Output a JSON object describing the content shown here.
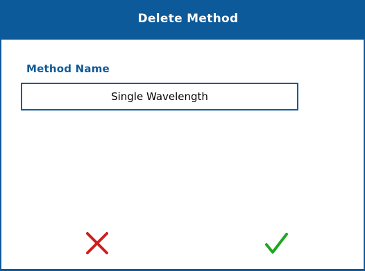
{
  "dialog": {
    "title": "Delete Method",
    "field_label": "Method Name",
    "method_name": "Single Wavelength"
  },
  "actions": {
    "cancel_icon": "red-x-icon",
    "confirm_icon": "green-checkmark-icon"
  },
  "colors": {
    "accent": "#0d5a9a",
    "cancel": "#cc1f1f",
    "confirm": "#1fa81f"
  }
}
